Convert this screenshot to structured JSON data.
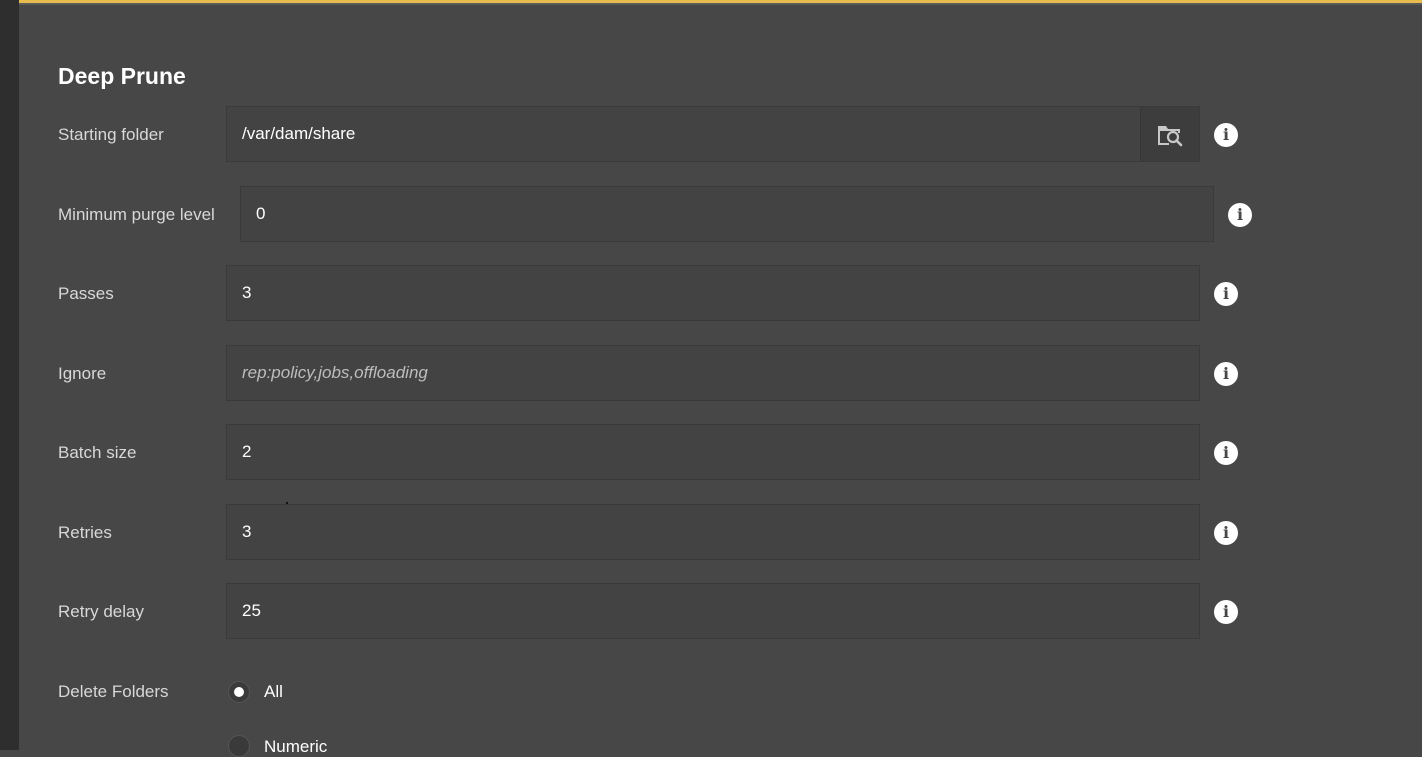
{
  "panel": {
    "title": "Deep Prune"
  },
  "fields": [
    {
      "label": "Starting folder",
      "value": "/var/dam/share",
      "placeholder": ""
    },
    {
      "label": "Minimum purge level",
      "value": "0",
      "placeholder": ""
    },
    {
      "label": "Passes",
      "value": "3",
      "placeholder": ""
    },
    {
      "label": "Ignore",
      "value": "",
      "placeholder": "rep:policy,jobs,offloading"
    },
    {
      "label": "Batch size",
      "value": "2",
      "placeholder": ""
    },
    {
      "label": "Retries",
      "value": "3",
      "placeholder": ""
    },
    {
      "label": "Retry delay",
      "value": "25",
      "placeholder": ""
    }
  ],
  "delete_folders": {
    "label": "Delete Folders",
    "options": [
      {
        "label": "All",
        "selected": true
      },
      {
        "label": "Numeric",
        "selected": false
      }
    ]
  },
  "icons": {
    "browse": "folder-search-icon",
    "info": "info-icon"
  },
  "colors": {
    "accent": "#e8bd4d",
    "background": "#474747",
    "field_background": "#434343"
  }
}
